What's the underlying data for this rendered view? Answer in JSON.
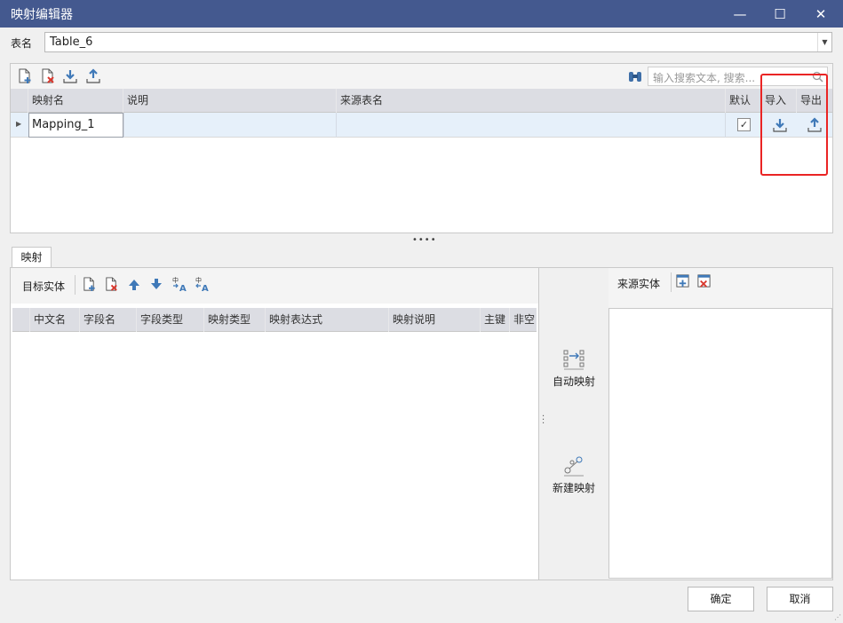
{
  "window": {
    "title": "映射编辑器",
    "minimize": "—",
    "maximize": "☐",
    "close": "✕"
  },
  "table_name": {
    "label": "表名",
    "value": "Table_6"
  },
  "top_toolbar": {
    "search_placeholder": "输入搜索文本, 搜索..."
  },
  "mapping_grid": {
    "columns": [
      "映射名",
      "说明",
      "来源表名",
      "默认",
      "导入",
      "导出"
    ],
    "rows": [
      {
        "name": "Mapping_1",
        "description": "",
        "source_table": "",
        "default": true
      }
    ]
  },
  "tab": {
    "label": "映射"
  },
  "target_entity": {
    "label": "目标实体",
    "columns": [
      "中文名",
      "字段名",
      "字段类型",
      "映射类型",
      "映射表达式",
      "映射说明",
      "主键",
      "非空"
    ]
  },
  "middle": {
    "auto_map": "自动映射",
    "new_map": "新建映射"
  },
  "source_entity": {
    "label": "来源实体"
  },
  "footer": {
    "ok": "确定",
    "cancel": "取消"
  },
  "colors": {
    "title_bar": "#44598f",
    "accent_blue": "#3f79b8",
    "delete_red": "#d9362c",
    "highlight_red": "#ea2424"
  }
}
